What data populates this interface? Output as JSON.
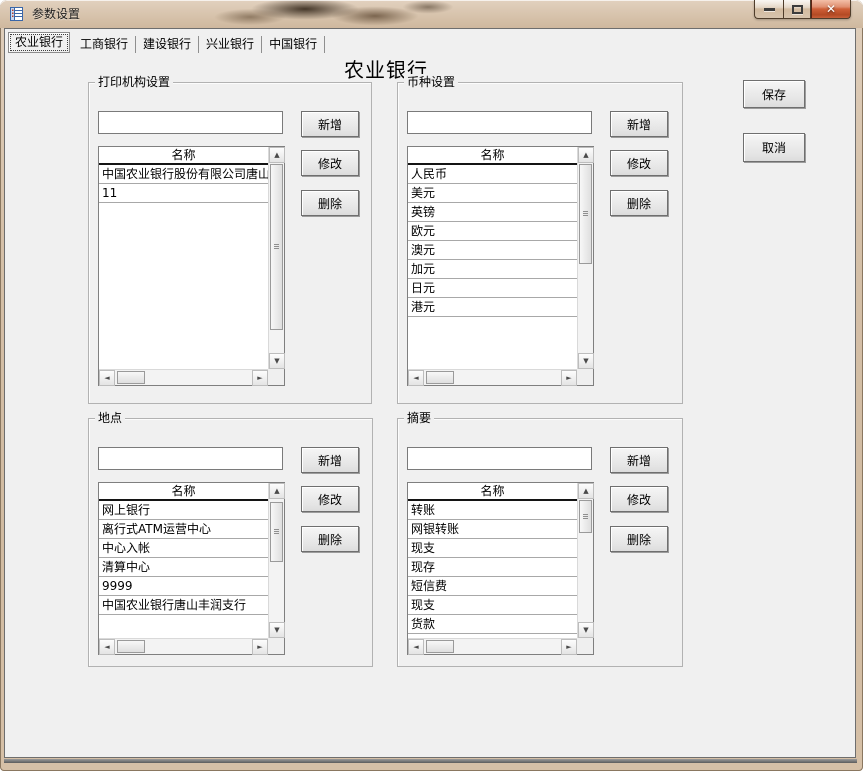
{
  "window": {
    "title": "参数设置",
    "app_icon": "form-list-icon"
  },
  "titlebar_controls": {
    "close_glyph": "✕"
  },
  "tabs": [
    {
      "label": "农业银行",
      "selected": true
    },
    {
      "label": "工商银行",
      "selected": false
    },
    {
      "label": "建设银行",
      "selected": false
    },
    {
      "label": "兴业银行",
      "selected": false
    },
    {
      "label": "中国银行",
      "selected": false
    }
  ],
  "heading": "农业银行",
  "side_actions": {
    "save": "保存",
    "cancel": "取消"
  },
  "groups": [
    {
      "title": "打印机构设置",
      "input": {
        "value": ""
      },
      "buttons": {
        "add": "新增",
        "edit": "修改",
        "delete": "删除"
      },
      "list": {
        "header": "名称",
        "items": [
          "中国农业银行股份有限公司唐山",
          "11"
        ]
      }
    },
    {
      "title": "币种设置",
      "input": {
        "value": ""
      },
      "buttons": {
        "add": "新增",
        "edit": "修改",
        "delete": "删除"
      },
      "list": {
        "header": "名称",
        "items": [
          "人民币",
          "美元",
          "英镑",
          "欧元",
          "澳元",
          "加元",
          "日元",
          "港元"
        ]
      }
    },
    {
      "title": "地点",
      "input": {
        "value": ""
      },
      "buttons": {
        "add": "新增",
        "edit": "修改",
        "delete": "删除"
      },
      "list": {
        "header": "名称",
        "items": [
          "网上银行",
          "离行式ATM运营中心",
          "中心入帐",
          "清算中心",
          "9999",
          "中国农业银行唐山丰润支行"
        ]
      }
    },
    {
      "title": "摘要",
      "input": {
        "value": ""
      },
      "buttons": {
        "add": "新增",
        "edit": "修改",
        "delete": "删除"
      },
      "list": {
        "header": "名称",
        "items": [
          "转账",
          "网银转账",
          "现支",
          "现存",
          "短信费",
          "现支",
          "货款"
        ]
      }
    }
  ],
  "icons": {
    "scroll_up": "▲",
    "scroll_down": "▼",
    "scroll_left": "◄",
    "scroll_right": "►"
  },
  "colors": {
    "titlebar_tan": "#d5c0a8",
    "close_button_red": "#c8603a",
    "client_bg": "#f0f0f0",
    "list_header_underline": "#141414"
  }
}
